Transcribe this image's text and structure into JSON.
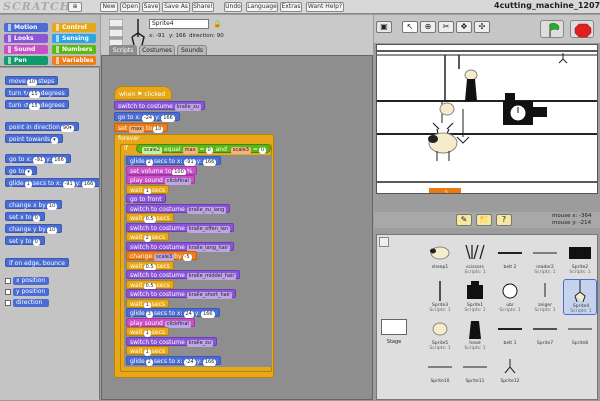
{
  "app": {
    "logo": "SCRATCH",
    "project_title": "4cutting_machine_120708",
    "menu": [
      "New",
      "Open",
      "Save",
      "Save As",
      "Share!",
      "Undo",
      "Language",
      "Extras",
      "Want Help?"
    ]
  },
  "categories": [
    {
      "label": "Motion",
      "color": "#4a6cd4"
    },
    {
      "label": "Control",
      "color": "#e6a819"
    },
    {
      "label": "Looks",
      "color": "#8a55d7"
    },
    {
      "label": "Sensing",
      "color": "#2ca5e2"
    },
    {
      "label": "Sound",
      "color": "#c94fc9"
    },
    {
      "label": "Numbers",
      "color": "#5cb712"
    },
    {
      "label": "Pen",
      "color": "#0e9a6c"
    },
    {
      "label": "Variables",
      "color": "#ee7d16"
    }
  ],
  "palette": {
    "move": {
      "a": "move",
      "v": "10",
      "b": "steps"
    },
    "turn_cw": {
      "a": "turn ↻",
      "v": "15",
      "b": "degrees"
    },
    "turn_ccw": {
      "a": "turn ↺",
      "v": "15",
      "b": "degrees"
    },
    "point_dir": {
      "a": "point in direction",
      "v": "90▾"
    },
    "point_towards": {
      "a": "point towards",
      "v": "▾"
    },
    "goto_xy": {
      "a": "go to x:",
      "x": "-91",
      "b": "y:",
      "y": "166"
    },
    "goto": {
      "a": "go to",
      "v": "▾"
    },
    "glide": {
      "a": "glide",
      "v": "1",
      "b": "secs to x:",
      "x": "-91",
      "c": "y:",
      "y": "166"
    },
    "change_x": {
      "a": "change x by",
      "v": "10"
    },
    "set_x": {
      "a": "set x to",
      "v": "0"
    },
    "change_y": {
      "a": "change y by",
      "v": "10"
    },
    "set_y": {
      "a": "set y to",
      "v": "0"
    },
    "bounce": "if on edge, bounce",
    "reporters": [
      "x position",
      "y position",
      "direction"
    ]
  },
  "sprite": {
    "name": "Sprite4",
    "x": "x: -91",
    "y": "y: 166",
    "direction": "direction: 90"
  },
  "tabs": [
    "Scripts",
    "Costumes",
    "Sounds"
  ],
  "script": {
    "hat": "when ⚑ clicked",
    "l1": {
      "a": "switch to costume",
      "d": "kralle_zu"
    },
    "l2": {
      "a": "go to x:",
      "x": "-24",
      "b": "y:",
      "y": "166"
    },
    "l3": {
      "a": "set",
      "d": "max",
      "b": "to",
      "v": "10"
    },
    "forever": "forever",
    "if_a": "if",
    "cond": {
      "a": "scale2",
      "b": "equal",
      "c": "max",
      "d": "=",
      "e": "0",
      "f": "and",
      "g": "scale3",
      "h": "=",
      "i": "0"
    },
    "body": [
      {
        "c": "c-mot",
        "a": "glide",
        "v": "2",
        "b": "secs to x:",
        "x": "-91",
        "c2": "y:",
        "y": "166"
      },
      {
        "c": "c-snd",
        "a": "set volume to",
        "v": "100",
        "b": "%"
      },
      {
        "c": "c-snd",
        "a": "play sound",
        "d": "clickfinal"
      },
      {
        "c": "c-ctl",
        "a": "wait",
        "v": "1",
        "b": "secs"
      },
      {
        "c": "c-look",
        "a": "go to front"
      },
      {
        "c": "c-look",
        "a": "switch to costume",
        "d": "kralle_zu_lang"
      },
      {
        "c": "c-ctl",
        "a": "wait",
        "v": "0.5",
        "b": "secs"
      },
      {
        "c": "c-look",
        "a": "switch to costume",
        "d": "kralle_offen_lan"
      },
      {
        "c": "c-ctl",
        "a": "wait",
        "v": "2",
        "b": "secs"
      },
      {
        "c": "c-look",
        "a": "switch to costume",
        "d": "kralle_lang_hair"
      },
      {
        "c": "c-var",
        "a": "change",
        "d": "scale3",
        "b": "by",
        "v": "-5"
      },
      {
        "c": "c-ctl",
        "a": "wait",
        "v": "0.5",
        "b": "secs"
      },
      {
        "c": "c-look",
        "a": "switch to costume",
        "d": "kralle_middel_hair"
      },
      {
        "c": "c-ctl",
        "a": "wait",
        "v": "0.5",
        "b": "secs"
      },
      {
        "c": "c-look",
        "a": "switch to costume",
        "d": "kralle_short_hair"
      },
      {
        "c": "c-ctl",
        "a": "wait",
        "v": "1",
        "b": "secs"
      },
      {
        "c": "c-mot",
        "a": "glide",
        "v": "3",
        "b": "secs to x:",
        "x": "24",
        "c2": "y:",
        "y": "166"
      },
      {
        "c": "c-snd",
        "a": "play sound",
        "d": "clickfinal"
      },
      {
        "c": "c-ctl",
        "a": "wait",
        "v": "1",
        "b": "secs"
      },
      {
        "c": "c-look",
        "a": "switch to costume",
        "d": "kralle_zu"
      },
      {
        "c": "c-ctl",
        "a": "wait",
        "v": "1",
        "b": "secs"
      },
      {
        "c": "c-mot",
        "a": "glide",
        "v": "2",
        "b": "secs to x:",
        "x": "-24",
        "c2": "y:",
        "y": "166"
      }
    ]
  },
  "stage": {
    "counter": "-2",
    "mouse_x": "mouse x: -364",
    "mouse_y": "mouse y: -214"
  },
  "sprites": [
    {
      "name": "sheep1",
      "sub": ""
    },
    {
      "name": "scissors",
      "sub": "Scripts: 1"
    },
    {
      "name": "belt 2",
      "sub": ""
    },
    {
      "name": "reader2",
      "sub": "Scripts: 1"
    },
    {
      "name": "Sprite2",
      "sub": "Scripts: 1"
    },
    {
      "name": "Sprite3",
      "sub": "Scripts: 1"
    },
    {
      "name": "Sprite1",
      "sub": "Scripts: 1"
    },
    {
      "name": "ubr",
      "sub": "Scripts: 1"
    },
    {
      "name": "zeiger",
      "sub": "Scripts: 1"
    },
    {
      "name": "Sprite4",
      "sub": "Scripts: 1"
    },
    {
      "name": "Sprite5",
      "sub": "Scripts: 1"
    },
    {
      "name": "head",
      "sub": "Scripts: 1"
    },
    {
      "name": "belt 1",
      "sub": ""
    },
    {
      "name": "Sprite7",
      "sub": ""
    },
    {
      "name": "Sprite8",
      "sub": ""
    },
    {
      "name": "Sprite10",
      "sub": ""
    },
    {
      "name": "Sprite11",
      "sub": ""
    },
    {
      "name": "Sprite12",
      "sub": ""
    }
  ],
  "stage_thumb_label": "Stage"
}
